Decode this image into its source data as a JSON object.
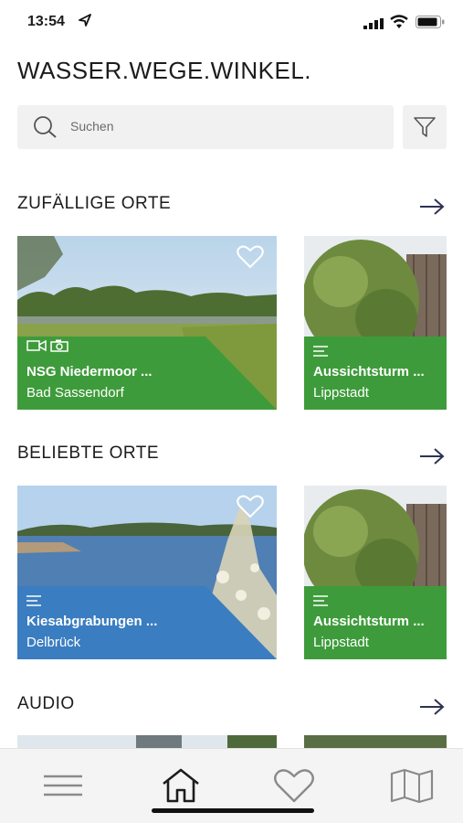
{
  "status": {
    "time": "13:54"
  },
  "app": {
    "title": "WASSER.WEGE.WINKEL."
  },
  "search": {
    "placeholder": "Suchen"
  },
  "sections": [
    {
      "title": "ZUFÄLLIGE ORTE",
      "cards": [
        {
          "name": "NSG Niedermoor ...",
          "city": "Bad Sassendorf",
          "color": "#3e9b3b",
          "media": [
            "video-icon",
            "camera-icon"
          ]
        },
        {
          "name": "Aussichtsturm ...",
          "city": "Lippstadt",
          "color": "#3e9b3b",
          "media": [
            "text-icon"
          ]
        }
      ]
    },
    {
      "title": "BELIEBTE ORTE",
      "cards": [
        {
          "name": "Kiesabgrabungen ...",
          "city": "Delbrück",
          "color": "#3a7dc0",
          "media": [
            "text-icon"
          ]
        },
        {
          "name": "Aussichtsturm ...",
          "city": "Lippstadt",
          "color": "#3e9b3b",
          "media": [
            "text-icon"
          ]
        }
      ]
    },
    {
      "title": "AUDIO",
      "cards": []
    }
  ],
  "tabs": [
    "menu-icon",
    "home-icon",
    "heart-icon",
    "map-icon"
  ]
}
